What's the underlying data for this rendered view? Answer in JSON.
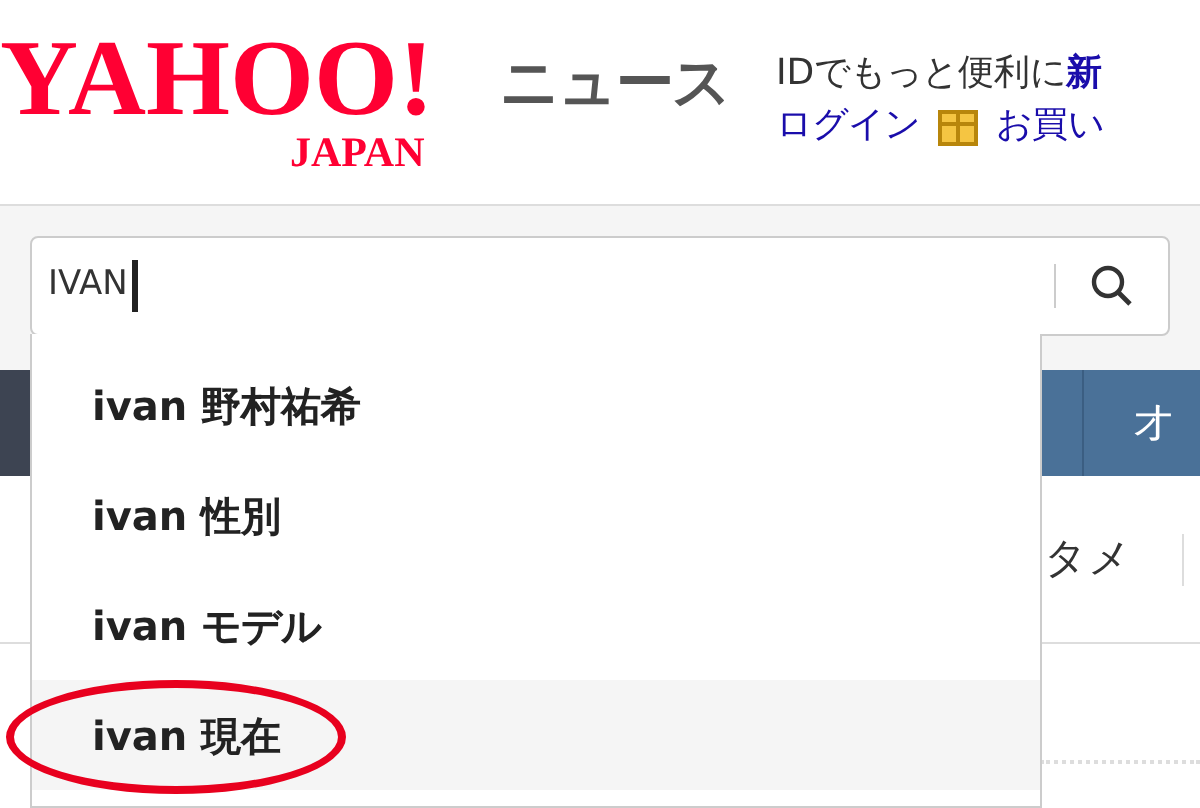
{
  "header": {
    "logo": {
      "main": "YAHOO!",
      "sub": "JAPAN"
    },
    "service": "ニュース",
    "promo": {
      "text": "IDでもっと便利に",
      "link": "新"
    },
    "login": "ログイン",
    "shopping": "お買い"
  },
  "search": {
    "value": "IVAN",
    "focused": true
  },
  "suggestions": [
    {
      "text": "ivan 野村祐希",
      "selected": false,
      "circled": false
    },
    {
      "text": "ivan 性別",
      "selected": false,
      "circled": false
    },
    {
      "text": "ivan モデル",
      "selected": false,
      "circled": false
    },
    {
      "text": "ivan 現在",
      "selected": true,
      "circled": true
    }
  ],
  "nav": {
    "tab": "オ"
  },
  "subnav": {
    "tab": "タメ"
  }
}
